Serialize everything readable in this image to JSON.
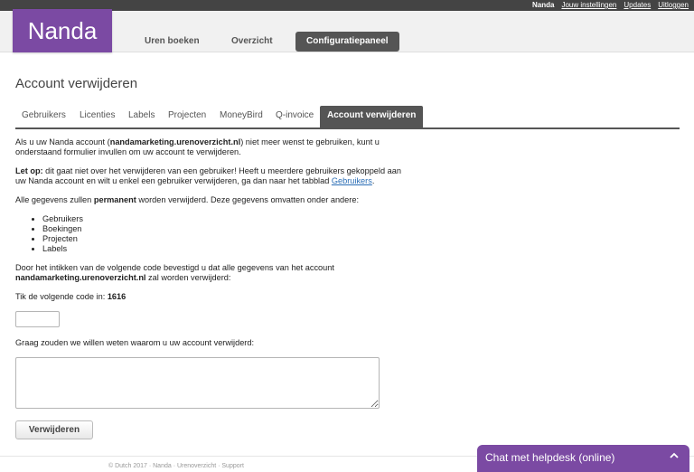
{
  "topbar": {
    "user": "Nanda",
    "links": [
      "Jouw instellingen",
      "Updates",
      "Uitloggen"
    ]
  },
  "header": {
    "logo": "Nanda",
    "nav": [
      "Uren boeken",
      "Overzicht",
      "Configuratiepaneel"
    ],
    "active_nav": "Configuratiepaneel"
  },
  "page": {
    "title": "Account verwijderen",
    "tabs": [
      "Gebruikers",
      "Licenties",
      "Labels",
      "Projecten",
      "MoneyBird",
      "Q-invoice",
      "Account verwijderen"
    ],
    "active_tab": "Account verwijderen"
  },
  "content": {
    "intro_1": "Als u uw Nanda account (",
    "account": "nandamarketing.urenoverzicht.nl",
    "intro_2": ") niet meer wenst te gebruiken, kunt u onderstaand formulier invullen om uw account te verwijderen.",
    "warning_label": "Let op:",
    "warning_text": " dit gaat niet over het verwijderen van een gebruiker! Heeft u meerdere gebruikers gekoppeld aan uw Nanda account en wilt u enkel een gebruiker verwijderen, ga dan naar het tabblad ",
    "warning_link": "Gebruikers",
    "warning_end": ".",
    "data_1": "Alle gegevens zullen ",
    "data_bold": "permanent",
    "data_2": " worden verwijderd. Deze gegevens omvatten onder andere:",
    "data_items": [
      "Gebruikers",
      "Boekingen",
      "Projecten",
      "Labels"
    ],
    "confirm_1": "Door het intikken van de volgende code bevestigd u dat alle gegevens van het account ",
    "confirm_account": "nandamarketing.urenoverzicht.nl",
    "confirm_2": " zal worden verwijderd:",
    "code_label": "Tik de volgende code in: ",
    "code": "1616",
    "code_value": "",
    "reason_label": "Graag zouden we willen weten waarom u uw account verwijderd:",
    "reason_value": "",
    "delete_button": "Verwijderen"
  },
  "footer": {
    "text": "© Dutch 2017 · Nanda · Urenoverzicht · Support"
  },
  "chat": {
    "label": "Chat met helpdesk (online)",
    "icon": "chevron-up-icon"
  },
  "colors": {
    "brand": "#7b4aa3",
    "dark": "#555555",
    "link": "#2a6db5",
    "topbar": "#444444"
  }
}
